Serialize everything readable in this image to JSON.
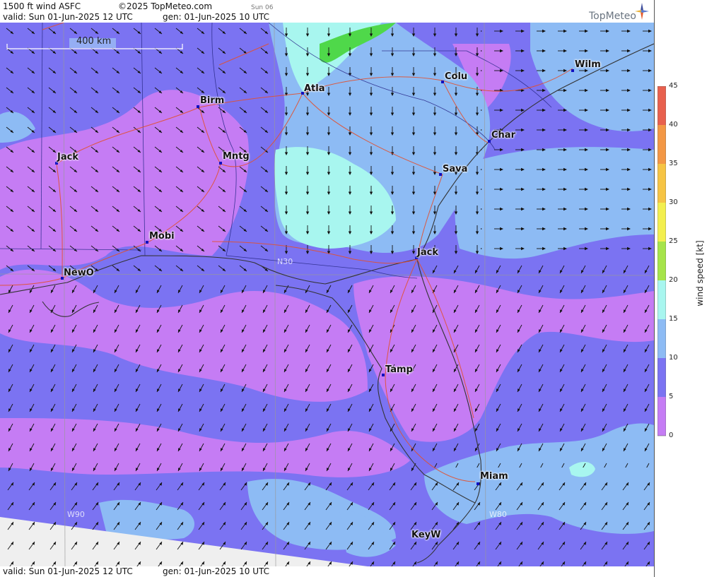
{
  "header": {
    "product": "1500 ft wind ASFC",
    "copyright": "©2025 TopMeteo.com",
    "day_tab": "Sun 06",
    "valid": "valid:  Sun  01-Jun-2025  12 UTC",
    "gen": "gen: 01-Jun-2025 10 UTC",
    "logo_text": "TopMeteo"
  },
  "footer": {
    "valid": "valid:  Sun  01-Jun-2025  12 UTC",
    "gen": "gen: 01-Jun-2025 10 UTC"
  },
  "map": {
    "scale_label": "400 km",
    "grid_labels": {
      "n30": "N30",
      "w90": "W90",
      "w80": "W80"
    },
    "cities": [
      {
        "label": "Birm"
      },
      {
        "label": "Atla"
      },
      {
        "label": "Colu"
      },
      {
        "label": "Wilm"
      },
      {
        "label": "Char"
      },
      {
        "label": "Sava"
      },
      {
        "label": "Jack"
      },
      {
        "label": "Mntg"
      },
      {
        "label": "Mobi"
      },
      {
        "label": "NewO"
      },
      {
        "label": "Jack"
      },
      {
        "label": "Tamp"
      },
      {
        "label": "Miam"
      },
      {
        "label": "KeyW"
      }
    ]
  },
  "legend": {
    "label": "wind speed [kt]",
    "ticks": [
      "45",
      "40",
      "35",
      "30",
      "25",
      "20",
      "15",
      "10",
      "5",
      "0"
    ],
    "colors": [
      "#e8604e",
      "#f39745",
      "#f6c444",
      "#f3ef4e",
      "#a6e44a",
      "#4fd84a",
      "#a8f6ef",
      "#8dbbf4",
      "#7b73f2",
      "#c57cf4"
    ]
  }
}
